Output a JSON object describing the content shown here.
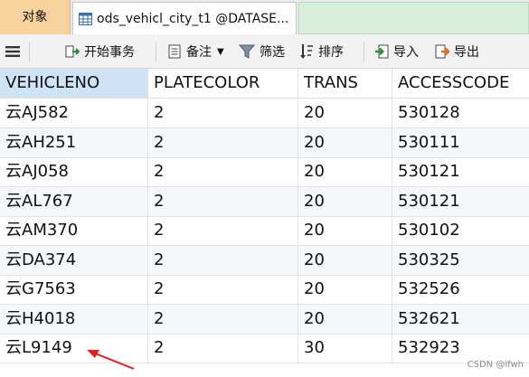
{
  "tabs": {
    "objects_label": "对象",
    "table_title": "ods_vehicl_city_t1 @DATASE..."
  },
  "toolbar": {
    "menu_icon": "hamburger-menu-icon",
    "begin_transaction": "开始事务",
    "note": "备注",
    "filter": "筛选",
    "sort": "排序",
    "import": "导入",
    "export": "导出"
  },
  "table": {
    "columns": [
      "VEHICLENO",
      "PLATECOLOR",
      "TRANS",
      "ACCESSCODE"
    ],
    "rows": [
      [
        "云AJ582",
        "2",
        "20",
        "530128"
      ],
      [
        "云AH251",
        "2",
        "20",
        "530111"
      ],
      [
        "云AJ058",
        "2",
        "20",
        "530121"
      ],
      [
        "云AL767",
        "2",
        "20",
        "530121"
      ],
      [
        "云AM370",
        "2",
        "20",
        "530102"
      ],
      [
        "云DA374",
        "2",
        "20",
        "530325"
      ],
      [
        "云G7563",
        "2",
        "20",
        "532526"
      ],
      [
        "云H4018",
        "2",
        "20",
        "532621"
      ],
      [
        "云L9149",
        "2",
        "30",
        "532923"
      ]
    ]
  },
  "watermark": "CSDN @lfwh",
  "colors": {
    "objects_tab": "#f7d29c",
    "green_tab": "#d8f0db",
    "selected_header": "#cfe3f6",
    "arrow": "#e02020"
  }
}
